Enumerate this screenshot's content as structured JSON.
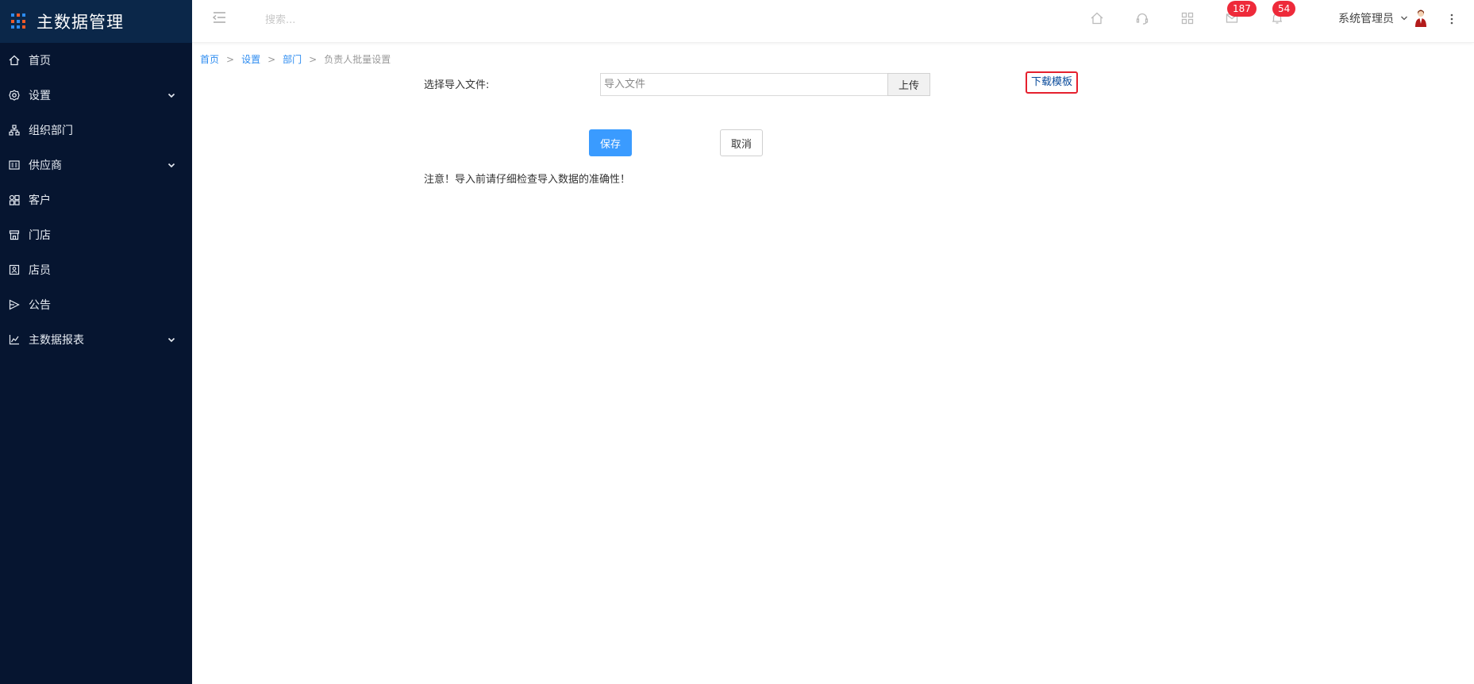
{
  "app": {
    "title": "主数据管理"
  },
  "colors": {
    "sidebar_bg": "#061530",
    "brand_bg": "#0b2749",
    "accent": "#3a9bff",
    "badge": "#ee2a3a",
    "highlight": "#e5202e"
  },
  "sidebar": {
    "items": [
      {
        "label": "首页",
        "icon": "home-icon",
        "expandable": false
      },
      {
        "label": "设置",
        "icon": "gear-icon",
        "expandable": true
      },
      {
        "label": "组织部门",
        "icon": "org-chart-icon",
        "expandable": false
      },
      {
        "label": "供应商",
        "icon": "supplier-card-icon",
        "expandable": true
      },
      {
        "label": "客户",
        "icon": "customer-grid-icon",
        "expandable": false
      },
      {
        "label": "门店",
        "icon": "store-icon",
        "expandable": false
      },
      {
        "label": "店员",
        "icon": "staff-badge-icon",
        "expandable": false
      },
      {
        "label": "公告",
        "icon": "announcement-icon",
        "expandable": false
      },
      {
        "label": "主数据报表",
        "icon": "line-chart-icon",
        "expandable": true
      }
    ]
  },
  "header": {
    "search_placeholder": "搜索...",
    "icons": [
      "home-icon",
      "headset-icon",
      "apps-grid-icon",
      "message-icon",
      "bell-icon"
    ],
    "message_badge": "187",
    "notification_badge": "54",
    "user_name": "系统管理员"
  },
  "breadcrumb": {
    "home": "首页",
    "settings": "设置",
    "department": "部门",
    "current": "负责人批量设置",
    "separator": ">"
  },
  "form": {
    "file_label": "选择导入文件:",
    "file_placeholder": "导入文件",
    "upload_label": "上传",
    "download_template": "下载模板",
    "save_label": "保存",
    "cancel_label": "取消",
    "notice": "注意！导入前请仔细检查导入数据的准确性！"
  }
}
